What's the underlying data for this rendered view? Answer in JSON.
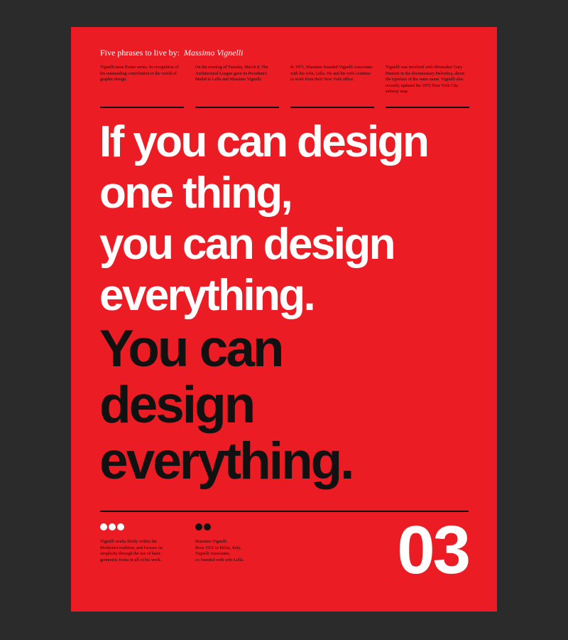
{
  "header": {
    "title": "Five phrases to live by:",
    "author": "Massimo Vignelli"
  },
  "columns": [
    {
      "text": "Vignelli-isms Poster series. In recognition of his outstanding contribution to the world of graphic design."
    },
    {
      "text": "On the evening of Tuesday, March 8, The Architectural League gave its President's Medal to Lella and Massimo Vignelli."
    },
    {
      "text": "In 1971, Massimo founded Vignelli Associates with his wife, Lella. He and his wife continue to work from their New York office."
    },
    {
      "text": "Vignelli was involved with filmmaker Gary Hustwit in the documentary Helvetica, about the typeface of the same name. Vignelli also recently updated his 1972 New York City subway map."
    }
  ],
  "headline": {
    "white_lines": [
      "If you can design",
      "one thing,",
      "you can design",
      "everything."
    ],
    "black_lines": [
      "You can",
      "design",
      "everything."
    ]
  },
  "footer": {
    "left_text": [
      "Vignelli works firmly within the",
      "Modernist tradition, and focuses on",
      "simplicity through the use of basic",
      "geometric forms in all of his work."
    ],
    "right_text": [
      "Massimo Vignelli",
      "Born 1931 in Milan, Italy,",
      "Vignelli Associates,",
      "co founded with wife Lella."
    ],
    "number": "03"
  },
  "colors": {
    "background": "#2b2b2b",
    "poster_red": "#ec1c24",
    "white": "#ffffff",
    "black": "#111111"
  }
}
